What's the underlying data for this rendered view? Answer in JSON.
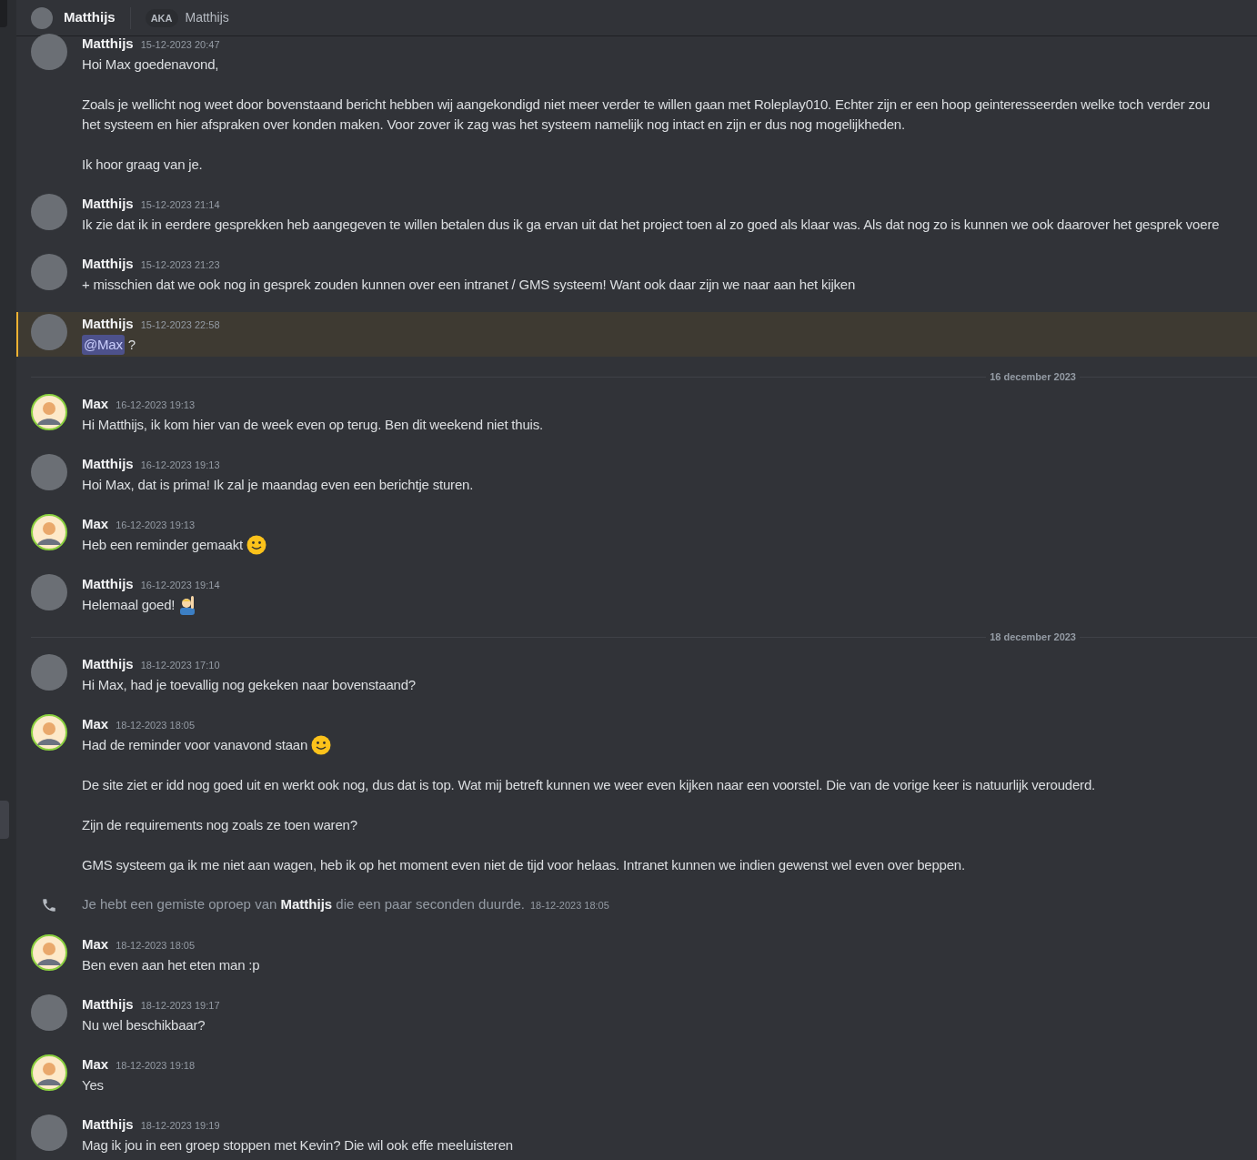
{
  "header": {
    "name": "Matthijs",
    "aka_label": "AKA",
    "aka_name": "Matthijs"
  },
  "entries": [
    {
      "kind": "message",
      "author": "Matthijs",
      "avatar": {
        "kind": "photo"
      },
      "timestamp": "15-12-2023 20:47",
      "highlighted": false,
      "paragraphs": [
        [
          "Hoi Max goedenavond,"
        ],
        [
          "Zoals je wellicht nog weet door bovenstaand bericht hebben wij aangekondigd niet meer verder te willen gaan met Roleplay010. Echter zijn er een hoop geinteresseerden welke toch verder zou",
          "het systeem en hier afspraken over konden maken. Voor zover ik zag was het systeem namelijk nog intact en zijn er dus nog mogelijkheden."
        ],
        [
          "Ik hoor graag van je."
        ]
      ]
    },
    {
      "kind": "message",
      "author": "Matthijs",
      "avatar": {
        "kind": "photo"
      },
      "timestamp": "15-12-2023 21:14",
      "highlighted": false,
      "paragraphs": [
        [
          "Ik zie dat ik in eerdere gesprekken heb aangegeven te willen betalen dus ik ga ervan uit dat het project toen al zo goed als klaar was. Als dat nog zo is kunnen we ook daarover het gesprek voere"
        ]
      ]
    },
    {
      "kind": "message",
      "author": "Matthijs",
      "avatar": {
        "kind": "photo"
      },
      "timestamp": "15-12-2023 21:23",
      "highlighted": false,
      "paragraphs": [
        [
          "+ misschien dat we ook nog in gesprek zouden kunnen over een intranet / GMS systeem! Want ook daar zijn we naar aan het kijken"
        ]
      ]
    },
    {
      "kind": "message",
      "author": "Matthijs",
      "avatar": {
        "kind": "photo"
      },
      "timestamp": "15-12-2023 22:58",
      "highlighted": true,
      "paragraphs": [
        [
          [
            {
              "kind": "mention",
              "text": "@Max"
            },
            {
              "kind": "text",
              "text": "?"
            }
          ]
        ]
      ]
    },
    {
      "kind": "divider",
      "label": "16 december 2023"
    },
    {
      "kind": "message",
      "author": "Max",
      "avatar": {
        "kind": "cartoon"
      },
      "timestamp": "16-12-2023 19:13",
      "highlighted": false,
      "paragraphs": [
        [
          "Hi Matthijs, ik kom hier van de week even op terug. Ben dit weekend niet thuis."
        ]
      ]
    },
    {
      "kind": "message",
      "author": "Matthijs",
      "avatar": {
        "kind": "photo"
      },
      "timestamp": "16-12-2023 19:13",
      "highlighted": false,
      "paragraphs": [
        [
          "Hoi Max, dat is prima! Ik zal je maandag even een berichtje sturen."
        ]
      ]
    },
    {
      "kind": "message",
      "author": "Max",
      "avatar": {
        "kind": "cartoon"
      },
      "timestamp": "16-12-2023 19:13",
      "highlighted": false,
      "paragraphs": [
        [
          [
            {
              "kind": "text",
              "text": "Heb een reminder gemaakt"
            },
            {
              "kind": "smile"
            }
          ]
        ]
      ]
    },
    {
      "kind": "message",
      "author": "Matthijs",
      "avatar": {
        "kind": "photo"
      },
      "timestamp": "16-12-2023 19:14",
      "highlighted": false,
      "paragraphs": [
        [
          [
            {
              "kind": "text",
              "text": "Helemaal goed!"
            },
            {
              "kind": "raised-hand"
            }
          ]
        ]
      ]
    },
    {
      "kind": "divider",
      "label": "18 december 2023"
    },
    {
      "kind": "message",
      "author": "Matthijs",
      "avatar": {
        "kind": "photo"
      },
      "timestamp": "18-12-2023 17:10",
      "highlighted": false,
      "paragraphs": [
        [
          "Hi Max, had je toevallig nog gekeken naar bovenstaand?"
        ]
      ]
    },
    {
      "kind": "message",
      "author": "Max",
      "avatar": {
        "kind": "cartoon"
      },
      "timestamp": "18-12-2023 18:05",
      "highlighted": false,
      "paragraphs": [
        [
          [
            {
              "kind": "text",
              "text": "Had de reminder voor vanavond staan"
            },
            {
              "kind": "smile"
            }
          ]
        ],
        [
          "De site ziet er idd nog goed uit en werkt ook nog, dus dat is top. Wat mij betreft kunnen we weer even kijken naar een voorstel. Die van de vorige keer is natuurlijk verouderd."
        ],
        [
          "Zijn de requirements nog zoals ze toen waren?"
        ],
        [
          "GMS systeem ga ik me niet aan wagen, heb ik op het moment even niet de tijd voor helaas. Intranet kunnen we indien gewenst wel even over beppen."
        ]
      ]
    },
    {
      "kind": "call",
      "text": "Je hebt een gemiste oproep van **Matthijs** die een paar seconden duurde.",
      "timestamp": "18-12-2023 18:05"
    },
    {
      "kind": "message",
      "author": "Max",
      "avatar": {
        "kind": "cartoon"
      },
      "timestamp": "18-12-2023 18:05",
      "highlighted": false,
      "paragraphs": [
        [
          "Ben even aan het eten man :p"
        ]
      ]
    },
    {
      "kind": "message",
      "author": "Matthijs",
      "avatar": {
        "kind": "photo"
      },
      "timestamp": "18-12-2023 19:17",
      "highlighted": false,
      "paragraphs": [
        [
          "Nu wel beschikbaar?"
        ]
      ]
    },
    {
      "kind": "message",
      "author": "Max",
      "avatar": {
        "kind": "cartoon"
      },
      "timestamp": "18-12-2023 19:18",
      "highlighted": false,
      "paragraphs": [
        [
          "Yes"
        ]
      ]
    },
    {
      "kind": "message",
      "author": "Matthijs",
      "avatar": {
        "kind": "photo"
      },
      "timestamp": "18-12-2023 19:19",
      "highlighted": false,
      "paragraphs": [
        [
          "Mag ik jou in een groep stoppen met Kevin? Die wil ook effe meeluisteren"
        ]
      ]
    }
  ]
}
